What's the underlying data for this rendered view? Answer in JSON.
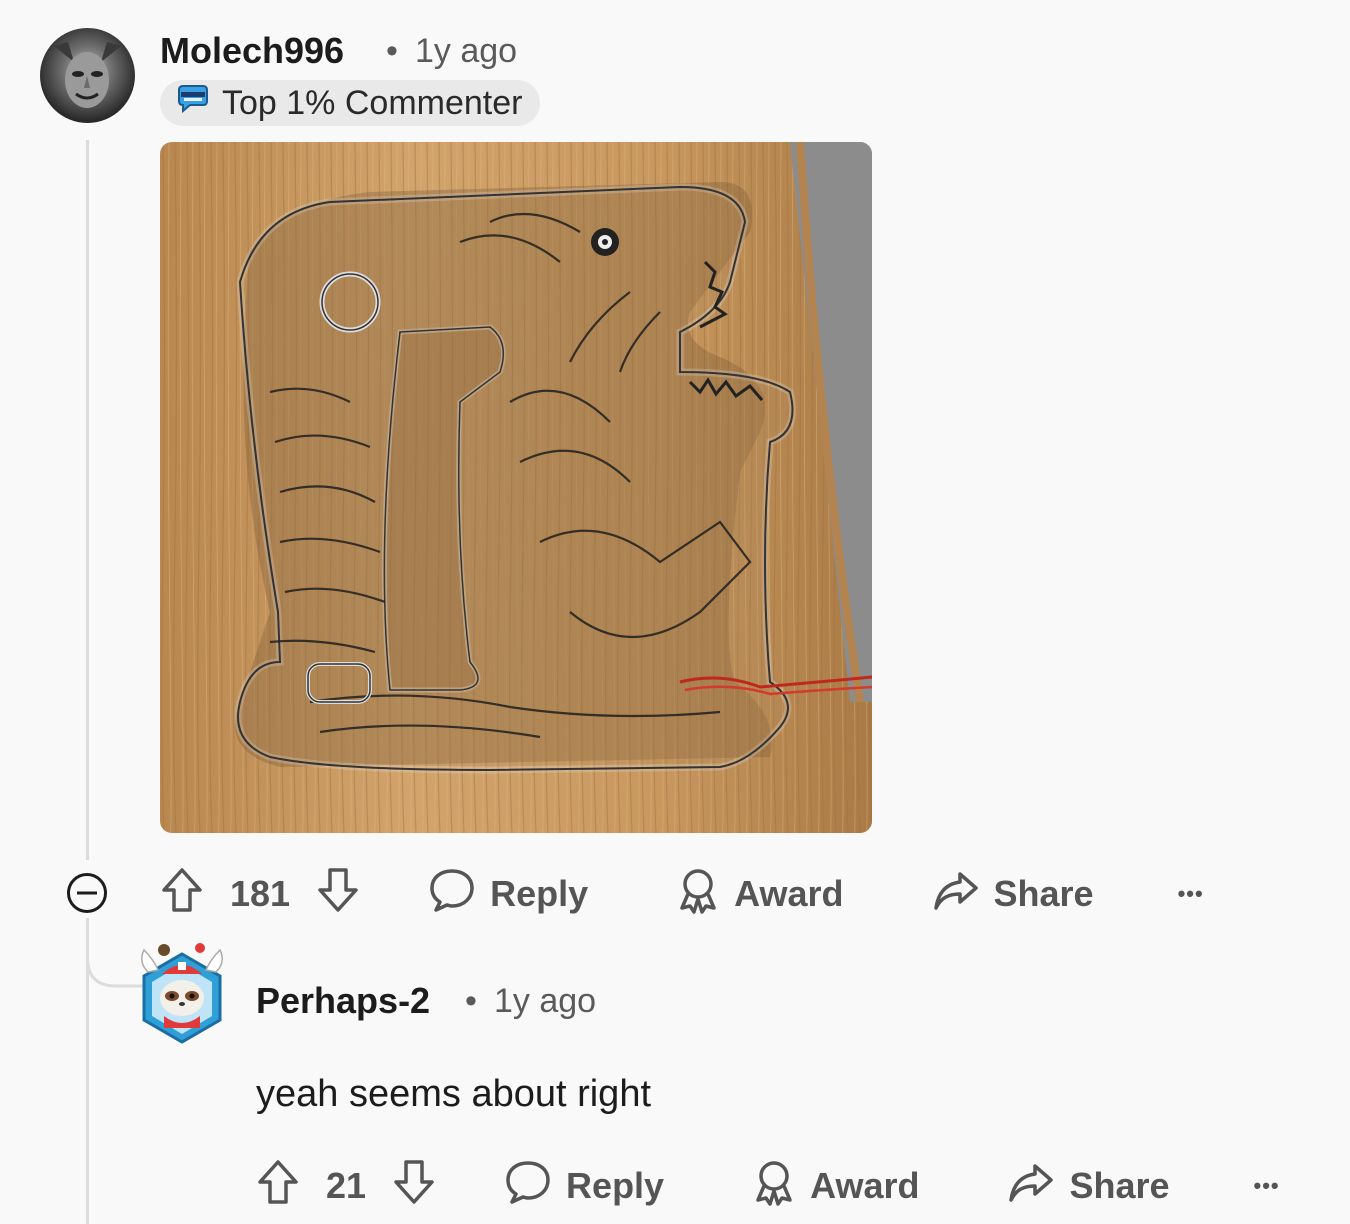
{
  "comment1": {
    "username": "Molech996",
    "separator": "•",
    "age": "1y ago",
    "flair": "Top 1% Commenter",
    "flair_icon": "commenter-badge-icon",
    "score": "181",
    "reply": "Reply",
    "award": "Award",
    "share": "Share",
    "more": "•••"
  },
  "comment2": {
    "username": "Perhaps-2",
    "separator": "•",
    "age": "1y ago",
    "body": "yeah seems about right",
    "score": "21",
    "reply": "Reply",
    "award": "Award",
    "share": "Share",
    "more": "•••"
  },
  "colors": {
    "background": "#f9f9f9",
    "thread_line": "#dcdcdc",
    "flair_bg": "#e9e9ea",
    "action_text": "#555555",
    "wood": "#c9a06a"
  }
}
